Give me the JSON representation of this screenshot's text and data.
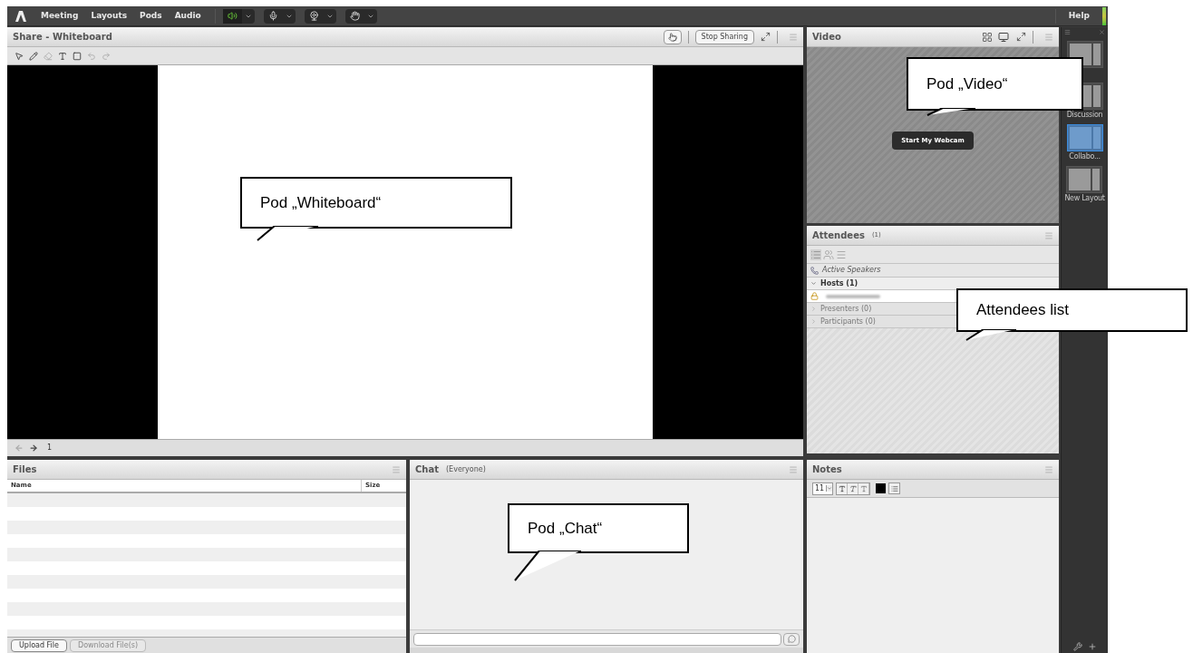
{
  "menubar": {
    "menus": [
      {
        "label": "Meeting"
      },
      {
        "label": "Layouts"
      },
      {
        "label": "Pods"
      },
      {
        "label": "Audio"
      }
    ],
    "devices": [
      {
        "kind": "speaker",
        "on": true
      },
      {
        "kind": "microphone",
        "on": false
      },
      {
        "kind": "camera",
        "on": false
      },
      {
        "kind": "hand",
        "on": false
      }
    ],
    "help": "Help"
  },
  "whiteboard": {
    "title": "Share - Whiteboard",
    "stop_button": "Stop Sharing",
    "tools": [
      {
        "kind": "select",
        "disabled": false
      },
      {
        "kind": "pen",
        "disabled": false
      },
      {
        "kind": "eraser",
        "disabled": true
      },
      {
        "kind": "text",
        "disabled": false
      },
      {
        "kind": "shape",
        "disabled": false
      },
      {
        "kind": "undo",
        "disabled": true
      },
      {
        "kind": "redo",
        "disabled": true
      }
    ],
    "nav": [
      {
        "kind": "prev",
        "disabled": true
      },
      {
        "kind": "next",
        "disabled": false
      }
    ],
    "page": "1"
  },
  "video": {
    "title": "Video",
    "webcam_button": "Start My Webcam"
  },
  "attendees": {
    "title": "Attendees",
    "count": "(1)",
    "active_speakers": "Active Speakers",
    "groups": [
      {
        "label": "Hosts (1)",
        "expanded": true,
        "members": [
          {
            "kind": "blurred"
          }
        ]
      },
      {
        "label": "Presenters (0)",
        "expanded": false
      },
      {
        "label": "Participants (0)",
        "expanded": false
      }
    ]
  },
  "files": {
    "title": "Files",
    "columns": [
      "Name",
      "Size"
    ],
    "buttons": [
      {
        "label": "Upload File",
        "disabled": false
      },
      {
        "label": "Download File(s)",
        "disabled": true
      }
    ]
  },
  "chat": {
    "title": "Chat",
    "audience": "(Everyone)"
  },
  "notes": {
    "title": "Notes",
    "font_size": "11",
    "format": [
      {
        "kind": "bold"
      },
      {
        "kind": "italic"
      },
      {
        "kind": "underline"
      }
    ]
  },
  "layouts": [
    {
      "selected": false
    },
    {
      "label": "Discussion",
      "selected": false
    },
    {
      "label": "Collabo...",
      "selected": true
    },
    {
      "label": "New Layout",
      "selected": false
    }
  ],
  "callouts": [
    {
      "text": "Pod „Whiteboard“"
    },
    {
      "text": "Pod „Video“"
    },
    {
      "text": "Attendees list"
    },
    {
      "text": "Pod „Chat“"
    }
  ]
}
